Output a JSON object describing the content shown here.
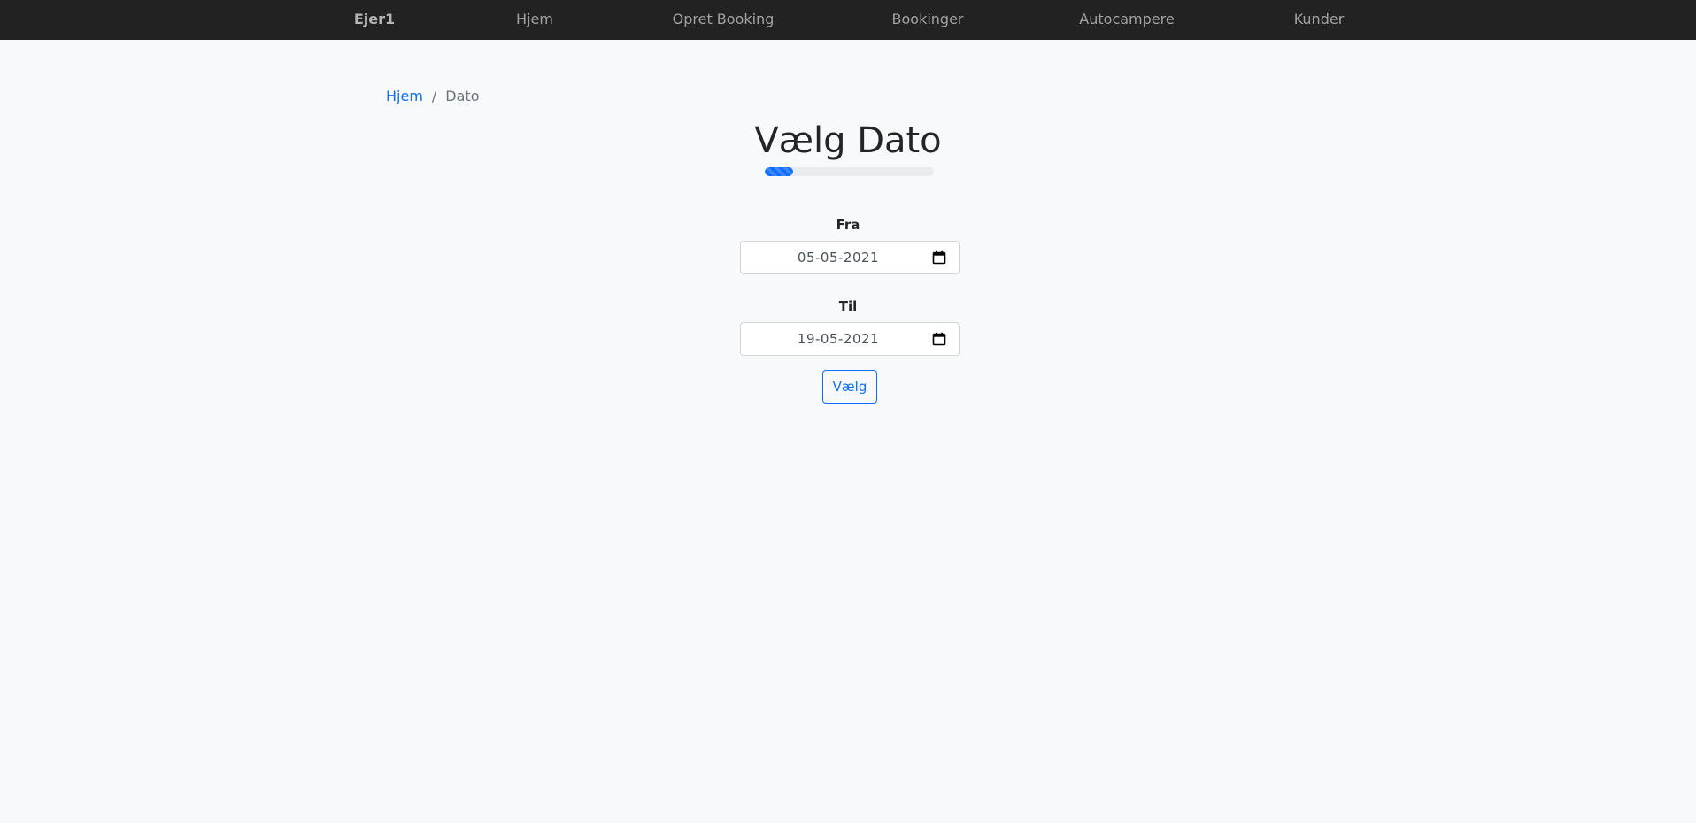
{
  "nav": {
    "brand": "Ejer1",
    "items": [
      "Hjem",
      "Opret Booking",
      "Bookinger",
      "Autocampere",
      "Kunder"
    ]
  },
  "breadcrumb": {
    "home": "Hjem",
    "separator": "/",
    "current": "Dato"
  },
  "page": {
    "title": "Vælg Dato",
    "progress_percent": 17
  },
  "form": {
    "from_label": "Fra",
    "from_value": "05-05-2021",
    "to_label": "Til",
    "to_value": "19-05-2021",
    "submit_label": "Vælg"
  },
  "icons": {
    "date_picker": "calendar-icon"
  },
  "colors": {
    "navbar": "#222222",
    "accent": "#0d6efd",
    "background": "#f8f9fa"
  }
}
